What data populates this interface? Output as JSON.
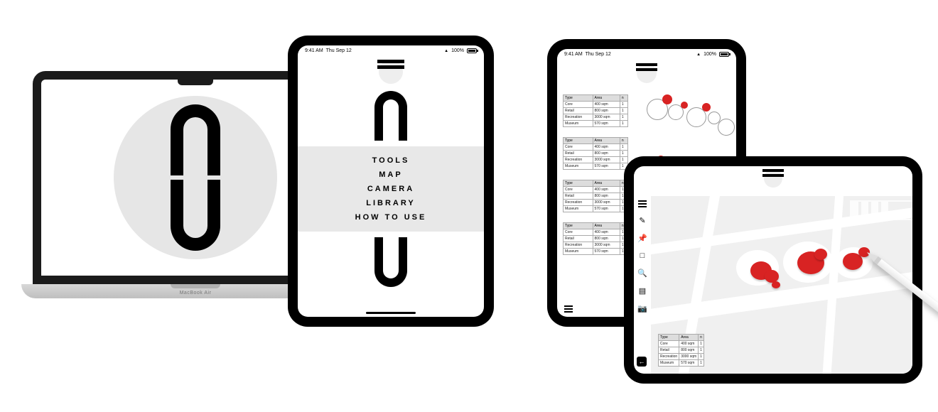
{
  "brand": {
    "macbook_label": "MacBook Air"
  },
  "status": {
    "time": "9:41 AM",
    "date": "Thu Sep 12",
    "battery": "100%"
  },
  "menu": {
    "items": [
      "TOOLS",
      "MAP",
      "CAMERA",
      "LIBRARY",
      "HOW TO USE"
    ]
  },
  "table_headers": {
    "c0": "Type",
    "c1": "Area",
    "c2": "n"
  },
  "space_tables": [
    [
      {
        "type": "Core",
        "area": "400 sqm",
        "n": "1"
      },
      {
        "type": "Retail",
        "area": "800 sqm",
        "n": "1"
      },
      {
        "type": "Recreation",
        "area": "3000 sqm",
        "n": "1"
      },
      {
        "type": "Museum",
        "area": "570 sqm",
        "n": "1"
      }
    ],
    [
      {
        "type": "Core",
        "area": "400 sqm",
        "n": "1"
      },
      {
        "type": "Retail",
        "area": "800 sqm",
        "n": "1"
      },
      {
        "type": "Recreation",
        "area": "3000 sqm",
        "n": "1"
      },
      {
        "type": "Museum",
        "area": "570 sqm",
        "n": "1"
      }
    ],
    [
      {
        "type": "Core",
        "area": "400 sqm",
        "n": "1"
      },
      {
        "type": "Retail",
        "area": "800 sqm",
        "n": "1"
      },
      {
        "type": "Recreation",
        "area": "3000 sqm",
        "n": "1"
      },
      {
        "type": "Museum",
        "area": "570 sqm",
        "n": "1"
      }
    ],
    [
      {
        "type": "Core",
        "area": "400 sqm",
        "n": "1"
      },
      {
        "type": "Retail",
        "area": "800 sqm",
        "n": "1"
      },
      {
        "type": "Recreation",
        "area": "3000 sqm",
        "n": "1"
      },
      {
        "type": "Museum",
        "area": "570 sqm",
        "n": "1"
      }
    ]
  ],
  "map_table": [
    {
      "type": "Core",
      "area": "400 sqm",
      "n": "1"
    },
    {
      "type": "Retail",
      "area": "800 sqm",
      "n": "1"
    },
    {
      "type": "Recreation",
      "area": "3000 sqm",
      "n": "1"
    },
    {
      "type": "Museum",
      "area": "570 sqm",
      "n": "1"
    }
  ],
  "tool_icons": [
    "hamburger-icon",
    "pen-icon",
    "pin-icon",
    "eraser-icon",
    "zoom-icon",
    "layers-icon",
    "camera-icon"
  ],
  "colors": {
    "accent_red": "#d82323",
    "band_grey": "#e8e8e8"
  }
}
